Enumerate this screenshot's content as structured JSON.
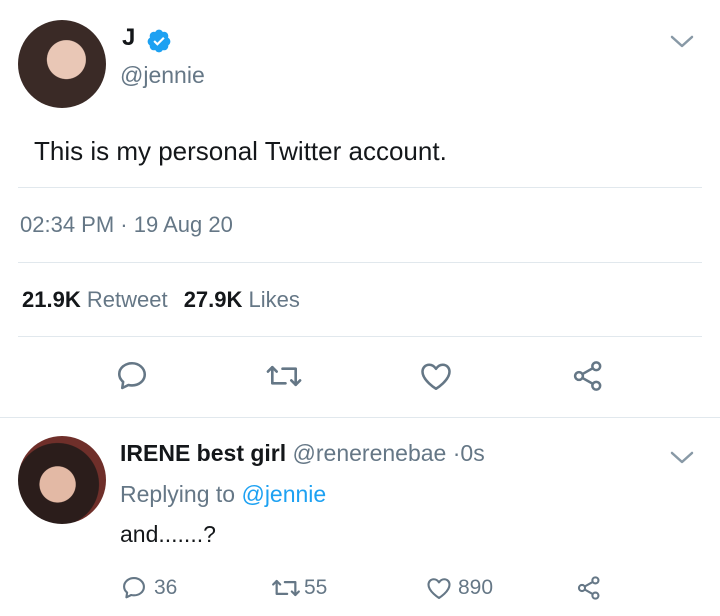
{
  "main_tweet": {
    "display_name": "J",
    "handle": "@jennie",
    "text": "This is my personal Twitter account.",
    "time": "02:34 PM",
    "separator": "·",
    "date": "19 Aug 20",
    "retweet_count": "21.9K",
    "retweet_label": "Retweet",
    "like_count": "27.9K",
    "like_label": "Likes"
  },
  "reply": {
    "display_name": "IRENE best girl",
    "handle": "@renerenebae",
    "separator": "·",
    "time": "0s",
    "replying_to_label": "Replying to",
    "replying_to_handle": "@jennie",
    "text": "and.......?",
    "reply_count": "36",
    "retweet_count": "55",
    "like_count": "890"
  },
  "colors": {
    "accent": "#1da1f2",
    "secondary_text": "#657786",
    "divider": "#e1e8ed",
    "icon": "#657786"
  },
  "icons": [
    "verified-badge-icon",
    "chevron-down-icon",
    "reply-icon",
    "retweet-icon",
    "like-icon",
    "share-icon"
  ]
}
